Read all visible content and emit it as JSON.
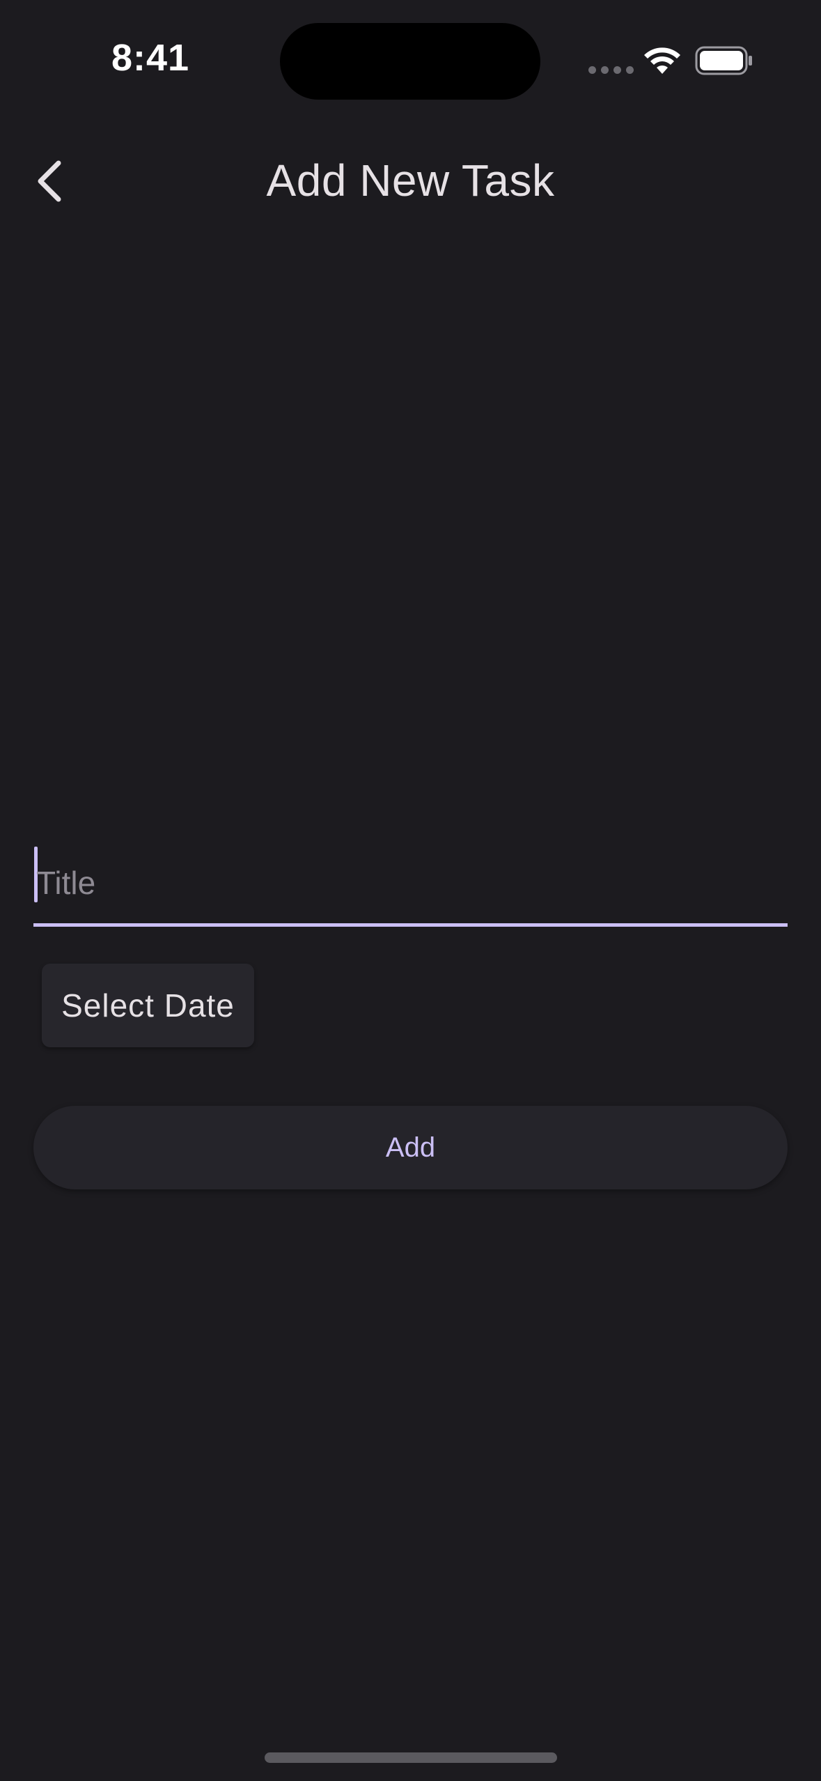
{
  "status_bar": {
    "time": "8:41",
    "icons": [
      "signal-dots-icon",
      "wifi-icon",
      "battery-icon"
    ]
  },
  "app_bar": {
    "back_icon": "chevron-left-icon",
    "title": "Add New Task"
  },
  "form": {
    "title_field": {
      "placeholder": "Title",
      "value": ""
    },
    "select_date_label": "Select Date",
    "add_label": "Add"
  },
  "colors": {
    "background": "#1c1b1f",
    "accent": "#cbbff5",
    "surface": "#25242a",
    "text": "#e6e1e5"
  }
}
